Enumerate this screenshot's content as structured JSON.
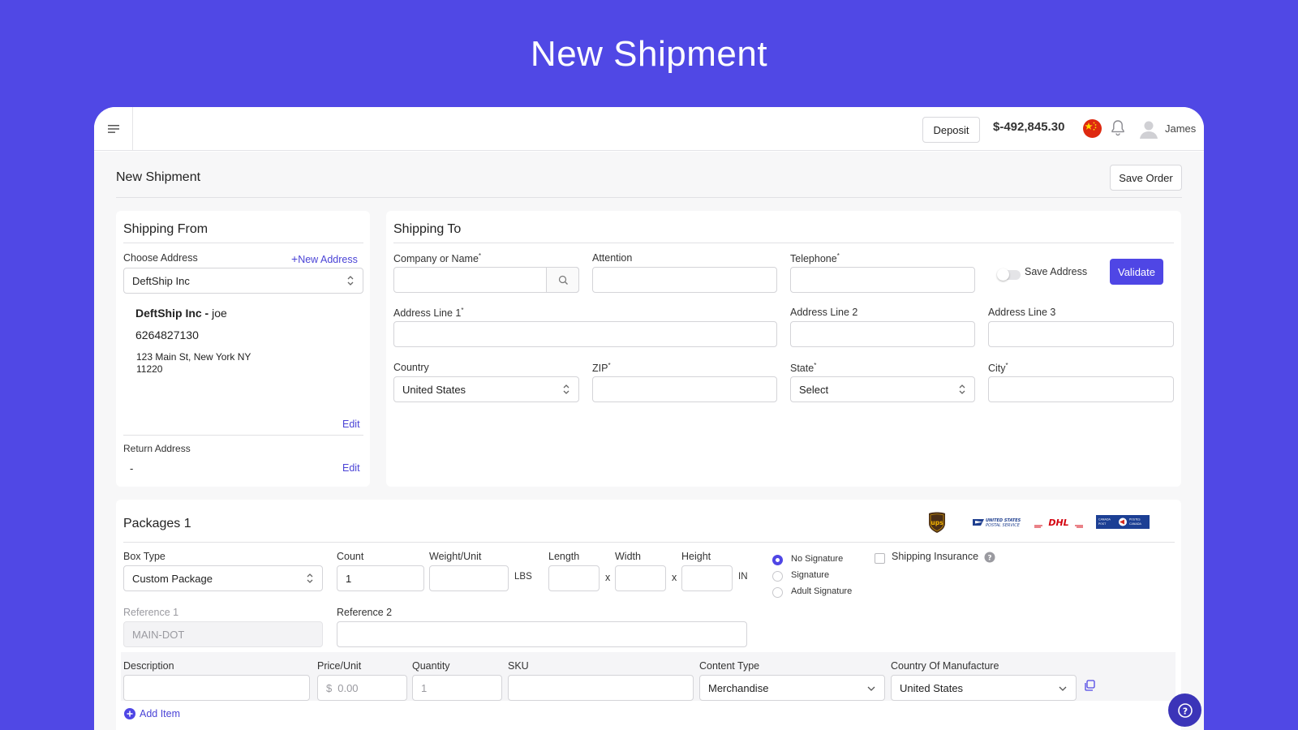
{
  "hero": {
    "title": "New Shipment"
  },
  "topbar": {
    "deposit_label": "Deposit",
    "balance": "$-492,845.30",
    "username": "James"
  },
  "page": {
    "title": "New Shipment",
    "save_order_label": "Save Order"
  },
  "shipping_from": {
    "title": "Shipping From",
    "choose_address_label": "Choose Address",
    "new_address_label": "New Address",
    "selected_address": "DeftShip Inc",
    "company": "DeftShip Inc",
    "separator": " - ",
    "contact": "joe",
    "phone": "6264827130",
    "street": "123 Main St, New York NY",
    "zip": "11220",
    "edit_label": "Edit",
    "return_address_label": "Return Address",
    "return_address_value": "-",
    "return_edit_label": "Edit"
  },
  "shipping_to": {
    "title": "Shipping To",
    "company_label": "Company or Name",
    "attention_label": "Attention",
    "telephone_label": "Telephone",
    "save_address_label": "Save Address",
    "validate_label": "Validate",
    "address1_label": "Address Line 1",
    "address2_label": "Address Line 2",
    "address3_label": "Address Line 3",
    "country_label": "Country",
    "country_value": "United States",
    "zip_label": "ZIP",
    "state_label": "State",
    "state_value": "Select",
    "city_label": "City",
    "required_mark": "*"
  },
  "packages": {
    "title": "Packages 1",
    "carriers": [
      "ups-logo",
      "usps-logo",
      "dhl-logo",
      "canada-post-logo"
    ],
    "box_type_label": "Box Type",
    "box_type_value": "Custom Package",
    "count_label": "Count",
    "count_value": "1",
    "weight_label": "Weight/Unit",
    "weight_unit": "LBS",
    "length_label": "Length",
    "width_label": "Width",
    "height_label": "Height",
    "times": "x",
    "dim_unit": "IN",
    "signature_options": [
      "No Signature",
      "Signature",
      "Adult Signature"
    ],
    "selected_signature": "No Signature",
    "insurance_label": "Shipping Insurance",
    "reference1_label": "Reference 1",
    "reference1_placeholder": "MAIN-DOT",
    "reference2_label": "Reference 2",
    "items": {
      "description_label": "Description",
      "price_label": "Price/Unit",
      "price_prefix": "$",
      "price_placeholder": "0.00",
      "quantity_label": "Quantity",
      "quantity_placeholder": "1",
      "sku_label": "SKU",
      "content_type_label": "Content Type",
      "content_type_value": "Merchandise",
      "country_manufacture_label": "Country Of Manufacture",
      "country_manufacture_value": "United States",
      "add_item_label": "Add Item"
    }
  },
  "colors": {
    "brand": "#5048e5",
    "accent": "#4f46e5",
    "link": "#4a43d6"
  }
}
